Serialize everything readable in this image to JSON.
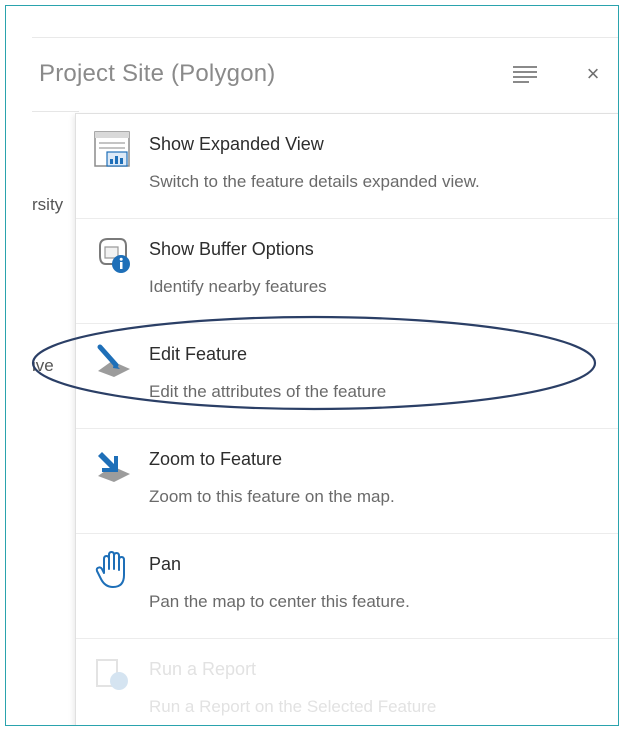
{
  "panel": {
    "title": "Project Site (Polygon)",
    "close_glyph": "×"
  },
  "background_labels": [
    "rsity",
    "ive"
  ],
  "menu": {
    "items": [
      {
        "label": "Show Expanded View",
        "description": "Switch to the feature details expanded view.",
        "icon": "expanded-view-icon",
        "enabled": true
      },
      {
        "label": "Show Buffer Options",
        "description": "Identify nearby features",
        "icon": "buffer-options-icon",
        "enabled": true
      },
      {
        "label": "Edit Feature",
        "description": "Edit the attributes of the feature",
        "icon": "edit-feature-icon",
        "enabled": true
      },
      {
        "label": "Zoom to Feature",
        "description": "Zoom to this feature on the map.",
        "icon": "zoom-feature-icon",
        "enabled": true
      },
      {
        "label": "Pan",
        "description": "Pan the map to center this feature.",
        "icon": "pan-hand-icon",
        "enabled": true
      },
      {
        "label": "Run a Report",
        "description": "Run a Report on the Selected Feature",
        "icon": "report-icon",
        "enabled": false
      }
    ]
  },
  "colors": {
    "frame_border": "#2aa3ad",
    "highlight_ellipse": "#2b3f66",
    "icon_blue": "#1e6fb8"
  }
}
